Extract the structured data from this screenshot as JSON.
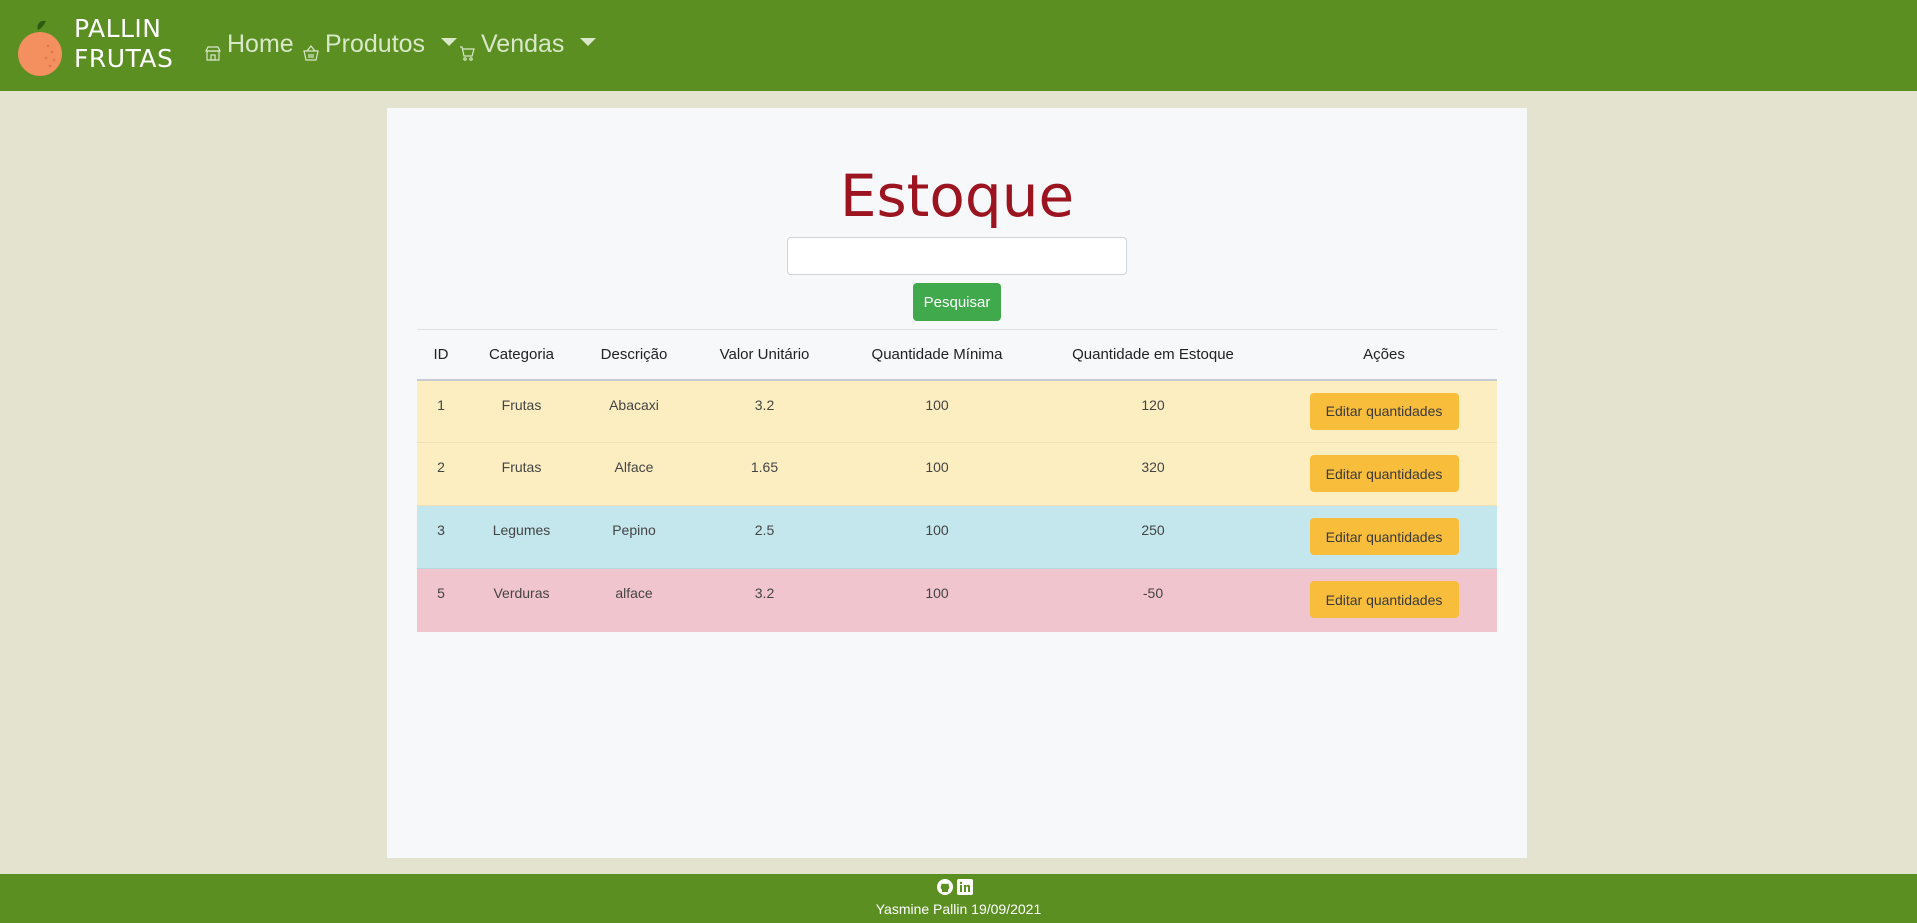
{
  "navbar": {
    "brand_line1": "PALLIN",
    "brand_line2": "FRUTAS",
    "items": [
      {
        "label": "Home",
        "icon": "store-icon"
      },
      {
        "label": "Produtos",
        "icon": "basket-icon",
        "dropdown": true
      },
      {
        "label": "Vendas",
        "icon": "cart-icon",
        "dropdown": true
      }
    ],
    "bg_color": "#5b8f22"
  },
  "main": {
    "title": "Estoque",
    "search": {
      "value": "",
      "placeholder": ""
    },
    "search_button": "Pesquisar",
    "table": {
      "headers": [
        "ID",
        "Categoria",
        "Descrição",
        "Valor Unitário",
        "Quantidade Mínima",
        "Quantidade em Estoque",
        "Ações"
      ],
      "rows": [
        {
          "id": "1",
          "categoria": "Frutas",
          "descricao": "Abacaxi",
          "valor": "3.2",
          "minima": "100",
          "estoque": "120",
          "acao": "Editar quantidades",
          "status": "warning"
        },
        {
          "id": "2",
          "categoria": "Frutas",
          "descricao": "Alface",
          "valor": "1.65",
          "minima": "100",
          "estoque": "320",
          "acao": "Editar quantidades",
          "status": "warning"
        },
        {
          "id": "3",
          "categoria": "Legumes",
          "descricao": "Pepino",
          "valor": "2.5",
          "minima": "100",
          "estoque": "250",
          "acao": "Editar quantidades",
          "status": "info"
        },
        {
          "id": "5",
          "categoria": "Verduras",
          "descricao": "alface",
          "valor": "3.2",
          "minima": "100",
          "estoque": "-50",
          "acao": "Editar quantidades",
          "status": "danger"
        }
      ]
    }
  },
  "footer": {
    "icons": [
      "github-icon",
      "linkedin-icon"
    ],
    "text": "Yasmine Pallin 19/09/2021"
  }
}
